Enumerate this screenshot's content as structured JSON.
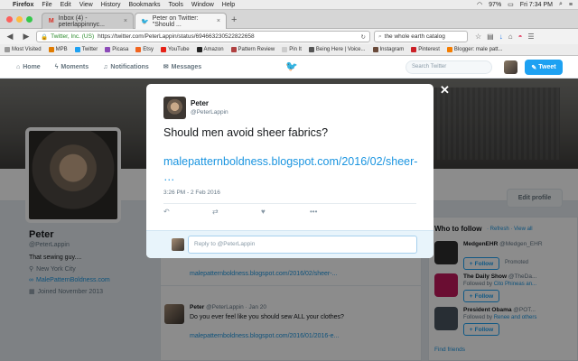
{
  "menubar": {
    "app": "Firefox",
    "items": [
      "File",
      "Edit",
      "View",
      "History",
      "Bookmarks",
      "Tools",
      "Window",
      "Help"
    ],
    "battery": "97%",
    "clock": "Fri 7:34 PM"
  },
  "tabs": [
    {
      "title": "Inbox (4) - peterlappinnyc...",
      "favicon": "gmail-icon"
    },
    {
      "title": "Peter on Twitter: \"Should ...",
      "favicon": "twitter-icon"
    }
  ],
  "navbar": {
    "security_name": "Twitter, Inc. (US)",
    "url": "https://twitter.com/PeterLappin/status/694663230522822658",
    "search_value": "the whole earth catalog"
  },
  "bookmarks": [
    "Most Visited",
    "MPB",
    "Twitter",
    "Picasa",
    "Etsy",
    "YouTube",
    "Amazon",
    "Pattern Review",
    "Pin It",
    "Being Here | Voice...",
    "Instagram",
    "Pinterest",
    "Blogger: male patt..."
  ],
  "twitter_nav": {
    "home": "Home",
    "moments": "Moments",
    "notifications": "Notifications",
    "messages": "Messages",
    "search_placeholder": "Search Twitter",
    "tweet_button": "Tweet"
  },
  "profile": {
    "name": "Peter",
    "handle": "@PeterLappin",
    "bio": "That sewing guy....",
    "location": "New York City",
    "website": "MalePatternBoldness.com",
    "joined": "Joined November 2013",
    "edit_button": "Edit profile"
  },
  "timeline": [
    {
      "link": "malepatternboldness.blogspot.com/2016/02/sheer-..."
    },
    {
      "name": "Peter",
      "handle": "@PeterLappin",
      "date": "· Jan 20",
      "text": "Do you ever feel like you should sew ALL your clothes?",
      "link": "malepatternboldness.blogspot.com/2016/01/2016-e..."
    }
  ],
  "who_to_follow": {
    "title": "Who to follow",
    "refresh": "· Refresh · View all",
    "follow_label": "Follow",
    "accounts": [
      {
        "name": "MedgenEHR",
        "handle": "@Medgen_EHR",
        "sub": "Promoted",
        "color": "#2f2f2f"
      },
      {
        "name": "The Daily Show",
        "handle": "@TheDa...",
        "sub_prefix": "Followed by ",
        "sub_link": "Cito Phineas an...",
        "color": "#c2185b"
      },
      {
        "name": "President Obama",
        "handle": "@POT...",
        "sub_prefix": "Followed by ",
        "sub_link": "Renee and others",
        "color": "#4a5560"
      }
    ],
    "find_friends": "Find friends"
  },
  "modal": {
    "name": "Peter",
    "handle": "@PeterLappin",
    "text": "Should men avoid sheer fabrics?",
    "link": "malepatternboldness.blogspot.com/2016/02/sheer- …",
    "timestamp": "3:26 PM - 2 Feb 2016",
    "reply_placeholder": "Reply to @PeterLappin"
  },
  "colors": {
    "twitter_blue": "#1da1f2",
    "link_blue": "#1b95e0"
  }
}
